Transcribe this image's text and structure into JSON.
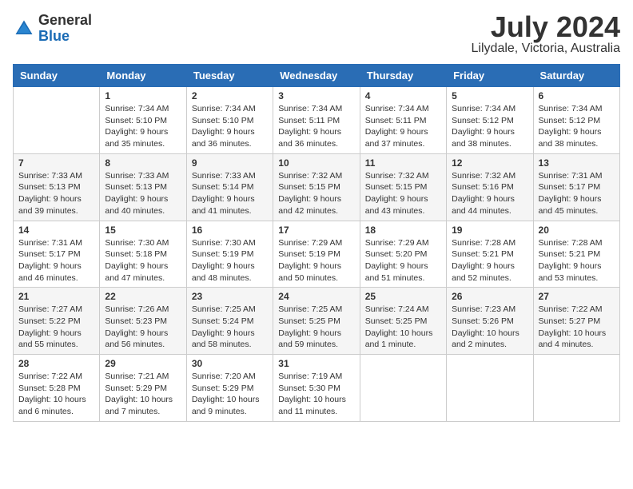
{
  "logo": {
    "general": "General",
    "blue": "Blue"
  },
  "title": "July 2024",
  "location": "Lilydale, Victoria, Australia",
  "days_header": [
    "Sunday",
    "Monday",
    "Tuesday",
    "Wednesday",
    "Thursday",
    "Friday",
    "Saturday"
  ],
  "weeks": [
    [
      {
        "day": "",
        "info": ""
      },
      {
        "day": "1",
        "info": "Sunrise: 7:34 AM\nSunset: 5:10 PM\nDaylight: 9 hours\nand 35 minutes."
      },
      {
        "day": "2",
        "info": "Sunrise: 7:34 AM\nSunset: 5:10 PM\nDaylight: 9 hours\nand 36 minutes."
      },
      {
        "day": "3",
        "info": "Sunrise: 7:34 AM\nSunset: 5:11 PM\nDaylight: 9 hours\nand 36 minutes."
      },
      {
        "day": "4",
        "info": "Sunrise: 7:34 AM\nSunset: 5:11 PM\nDaylight: 9 hours\nand 37 minutes."
      },
      {
        "day": "5",
        "info": "Sunrise: 7:34 AM\nSunset: 5:12 PM\nDaylight: 9 hours\nand 38 minutes."
      },
      {
        "day": "6",
        "info": "Sunrise: 7:34 AM\nSunset: 5:12 PM\nDaylight: 9 hours\nand 38 minutes."
      }
    ],
    [
      {
        "day": "7",
        "info": "Sunrise: 7:33 AM\nSunset: 5:13 PM\nDaylight: 9 hours\nand 39 minutes."
      },
      {
        "day": "8",
        "info": "Sunrise: 7:33 AM\nSunset: 5:13 PM\nDaylight: 9 hours\nand 40 minutes."
      },
      {
        "day": "9",
        "info": "Sunrise: 7:33 AM\nSunset: 5:14 PM\nDaylight: 9 hours\nand 41 minutes."
      },
      {
        "day": "10",
        "info": "Sunrise: 7:32 AM\nSunset: 5:15 PM\nDaylight: 9 hours\nand 42 minutes."
      },
      {
        "day": "11",
        "info": "Sunrise: 7:32 AM\nSunset: 5:15 PM\nDaylight: 9 hours\nand 43 minutes."
      },
      {
        "day": "12",
        "info": "Sunrise: 7:32 AM\nSunset: 5:16 PM\nDaylight: 9 hours\nand 44 minutes."
      },
      {
        "day": "13",
        "info": "Sunrise: 7:31 AM\nSunset: 5:17 PM\nDaylight: 9 hours\nand 45 minutes."
      }
    ],
    [
      {
        "day": "14",
        "info": "Sunrise: 7:31 AM\nSunset: 5:17 PM\nDaylight: 9 hours\nand 46 minutes."
      },
      {
        "day": "15",
        "info": "Sunrise: 7:30 AM\nSunset: 5:18 PM\nDaylight: 9 hours\nand 47 minutes."
      },
      {
        "day": "16",
        "info": "Sunrise: 7:30 AM\nSunset: 5:19 PM\nDaylight: 9 hours\nand 48 minutes."
      },
      {
        "day": "17",
        "info": "Sunrise: 7:29 AM\nSunset: 5:19 PM\nDaylight: 9 hours\nand 50 minutes."
      },
      {
        "day": "18",
        "info": "Sunrise: 7:29 AM\nSunset: 5:20 PM\nDaylight: 9 hours\nand 51 minutes."
      },
      {
        "day": "19",
        "info": "Sunrise: 7:28 AM\nSunset: 5:21 PM\nDaylight: 9 hours\nand 52 minutes."
      },
      {
        "day": "20",
        "info": "Sunrise: 7:28 AM\nSunset: 5:21 PM\nDaylight: 9 hours\nand 53 minutes."
      }
    ],
    [
      {
        "day": "21",
        "info": "Sunrise: 7:27 AM\nSunset: 5:22 PM\nDaylight: 9 hours\nand 55 minutes."
      },
      {
        "day": "22",
        "info": "Sunrise: 7:26 AM\nSunset: 5:23 PM\nDaylight: 9 hours\nand 56 minutes."
      },
      {
        "day": "23",
        "info": "Sunrise: 7:25 AM\nSunset: 5:24 PM\nDaylight: 9 hours\nand 58 minutes."
      },
      {
        "day": "24",
        "info": "Sunrise: 7:25 AM\nSunset: 5:25 PM\nDaylight: 9 hours\nand 59 minutes."
      },
      {
        "day": "25",
        "info": "Sunrise: 7:24 AM\nSunset: 5:25 PM\nDaylight: 10 hours\nand 1 minute."
      },
      {
        "day": "26",
        "info": "Sunrise: 7:23 AM\nSunset: 5:26 PM\nDaylight: 10 hours\nand 2 minutes."
      },
      {
        "day": "27",
        "info": "Sunrise: 7:22 AM\nSunset: 5:27 PM\nDaylight: 10 hours\nand 4 minutes."
      }
    ],
    [
      {
        "day": "28",
        "info": "Sunrise: 7:22 AM\nSunset: 5:28 PM\nDaylight: 10 hours\nand 6 minutes."
      },
      {
        "day": "29",
        "info": "Sunrise: 7:21 AM\nSunset: 5:29 PM\nDaylight: 10 hours\nand 7 minutes."
      },
      {
        "day": "30",
        "info": "Sunrise: 7:20 AM\nSunset: 5:29 PM\nDaylight: 10 hours\nand 9 minutes."
      },
      {
        "day": "31",
        "info": "Sunrise: 7:19 AM\nSunset: 5:30 PM\nDaylight: 10 hours\nand 11 minutes."
      },
      {
        "day": "",
        "info": ""
      },
      {
        "day": "",
        "info": ""
      },
      {
        "day": "",
        "info": ""
      }
    ]
  ]
}
